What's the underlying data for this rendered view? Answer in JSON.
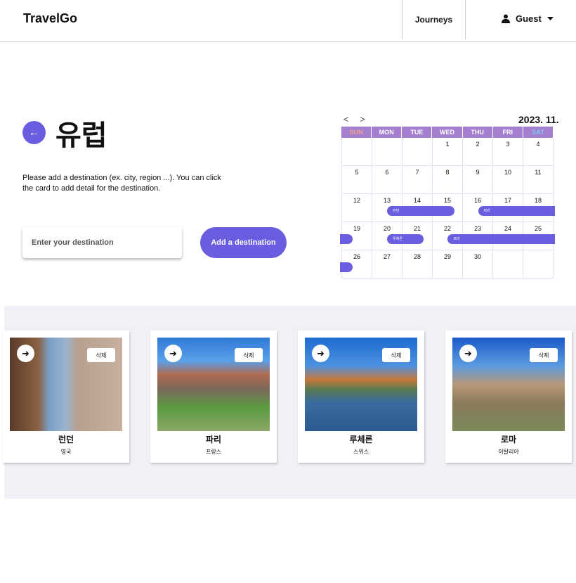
{
  "nav": {
    "logo": "TravelGo",
    "journeys": "Journeys",
    "user": "Guest"
  },
  "page": {
    "title": "유럽",
    "description": "Please add a destination (ex. city, region ...). You can click the card to add detail for the destination.",
    "input_placeholder": "Enter your destination",
    "add_button": "Add a destination"
  },
  "calendar": {
    "prev": "<",
    "next": ">",
    "month": "2023. 11.",
    "weekdays": [
      "SUN",
      "MON",
      "TUE",
      "WED",
      "THU",
      "FRI",
      "SAT"
    ],
    "days": [
      "",
      "",
      "",
      "1",
      "2",
      "3",
      "4",
      "5",
      "6",
      "7",
      "8",
      "9",
      "10",
      "11",
      "12",
      "13",
      "14",
      "15",
      "16",
      "17",
      "18",
      "19",
      "20",
      "21",
      "22",
      "23",
      "24",
      "25",
      "26",
      "27",
      "28",
      "29",
      "30",
      "",
      ""
    ],
    "events": [
      {
        "label": "런던",
        "start": 13,
        "end": 15
      },
      {
        "label": "파리",
        "start": 16,
        "end": 19
      },
      {
        "label": "루체른",
        "start": 20,
        "end": 21
      },
      {
        "label": "로마",
        "start": 22,
        "end": 26
      }
    ]
  },
  "colors": {
    "accent": "#6a5de0",
    "calendar_header": "#a47fd0",
    "sun": "#f4a58a",
    "sat": "#7ec8f0"
  },
  "cards": [
    {
      "name": "런던",
      "country": "영국",
      "delete": "삭제"
    },
    {
      "name": "파리",
      "country": "프랑스",
      "delete": "삭제"
    },
    {
      "name": "루체른",
      "country": "스위스",
      "delete": "삭제"
    },
    {
      "name": "로마",
      "country": "이탈리아",
      "delete": "삭제"
    }
  ]
}
